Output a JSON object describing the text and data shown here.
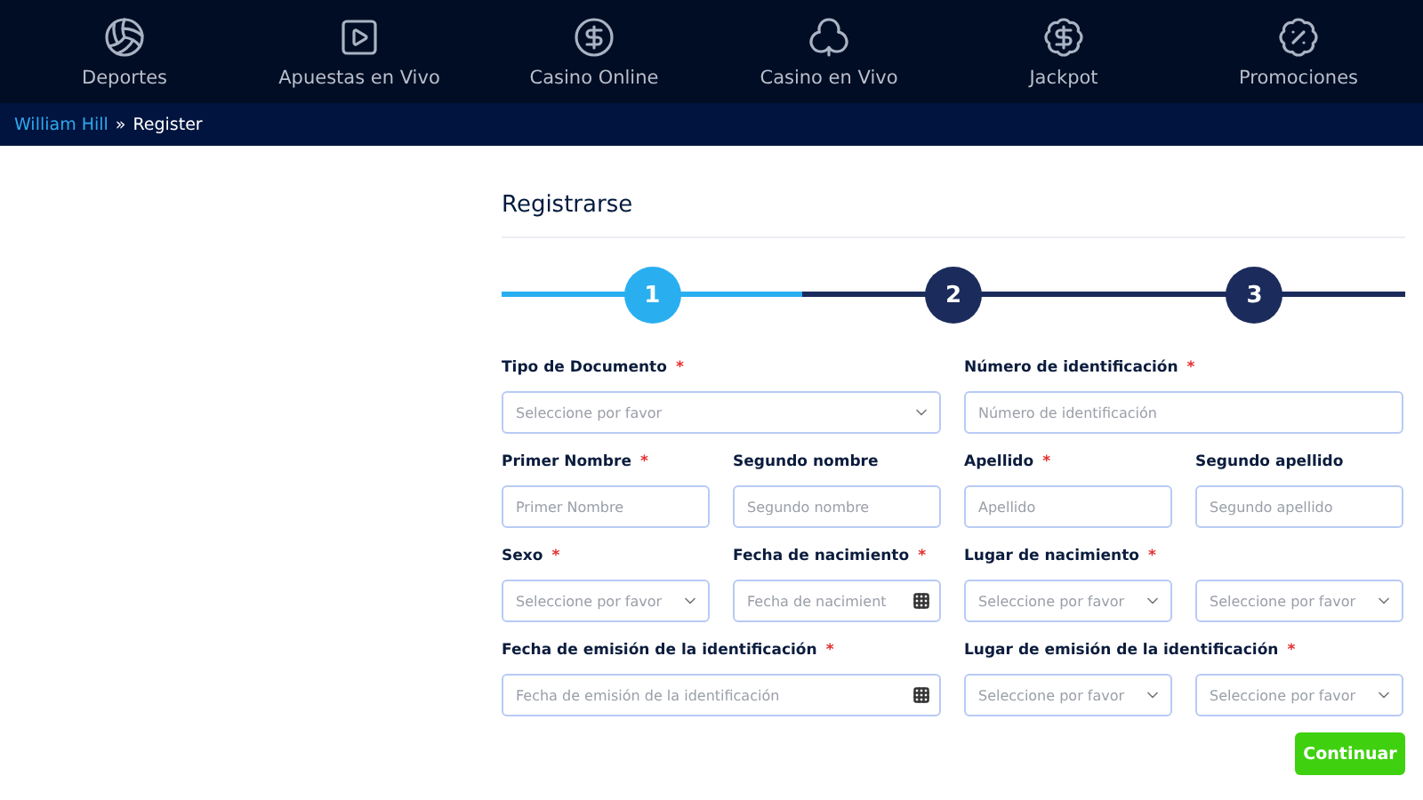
{
  "nav": [
    {
      "label": "Deportes"
    },
    {
      "label": "Apuestas en Vivo"
    },
    {
      "label": "Casino Online"
    },
    {
      "label": "Casino en Vivo"
    },
    {
      "label": "Jackpot"
    },
    {
      "label": "Promociones"
    }
  ],
  "breadcrumb": {
    "link": "William Hill",
    "separator": "»",
    "current": "Register"
  },
  "title": "Registrarse",
  "steps": [
    {
      "label": "1",
      "selected": true
    },
    {
      "label": "2",
      "selected": false
    },
    {
      "label": "3",
      "selected": false
    }
  ],
  "form_rows": [
    [
      {
        "label": "Tipo de Documento",
        "required": true,
        "inputs": [
          {
            "kind": "select",
            "placeholder": "Seleccione por favor"
          }
        ]
      },
      {
        "label": "Número de identificación",
        "required": true,
        "inputs": [
          {
            "kind": "text",
            "placeholder": "Número de identificación"
          }
        ]
      }
    ],
    [
      {
        "label": "Primer Nombre",
        "required": true,
        "inputs": [
          {
            "kind": "text",
            "placeholder": "Primer Nombre"
          }
        ]
      },
      {
        "label": "Segundo nombre",
        "required": false,
        "inputs": [
          {
            "kind": "text",
            "placeholder": "Segundo nombre"
          }
        ]
      },
      {
        "label": "Apellido",
        "required": true,
        "inputs": [
          {
            "kind": "text",
            "placeholder": "Apellido"
          }
        ]
      },
      {
        "label": "Segundo apellido",
        "required": false,
        "inputs": [
          {
            "kind": "text",
            "placeholder": "Segundo apellido"
          }
        ]
      }
    ],
    [
      {
        "label": "Sexo",
        "required": true,
        "inputs": [
          {
            "kind": "select",
            "placeholder": "Seleccione por favor"
          }
        ]
      },
      {
        "label": "Fecha de nacimiento",
        "required": true,
        "inputs": [
          {
            "kind": "date",
            "placeholder": "Fecha de nacimient"
          }
        ]
      },
      {
        "label": "Lugar de nacimiento",
        "required": true,
        "inputs": [
          {
            "kind": "select",
            "placeholder": "Seleccione por favor"
          },
          {
            "kind": "select",
            "placeholder": "Seleccione por favor"
          }
        ]
      }
    ],
    [
      {
        "label": "Fecha de emisión de la identificación",
        "required": true,
        "inputs": [
          {
            "kind": "date",
            "placeholder": "Fecha de emisión de la identificación"
          }
        ]
      },
      {
        "label": "Lugar de emisión de la identificación",
        "required": true,
        "inputs": [
          {
            "kind": "select",
            "placeholder": "Seleccione por favor"
          },
          {
            "kind": "select",
            "placeholder": "Seleccione por favor"
          }
        ]
      }
    ]
  ],
  "required_mark": "*",
  "submit": "Continuar"
}
